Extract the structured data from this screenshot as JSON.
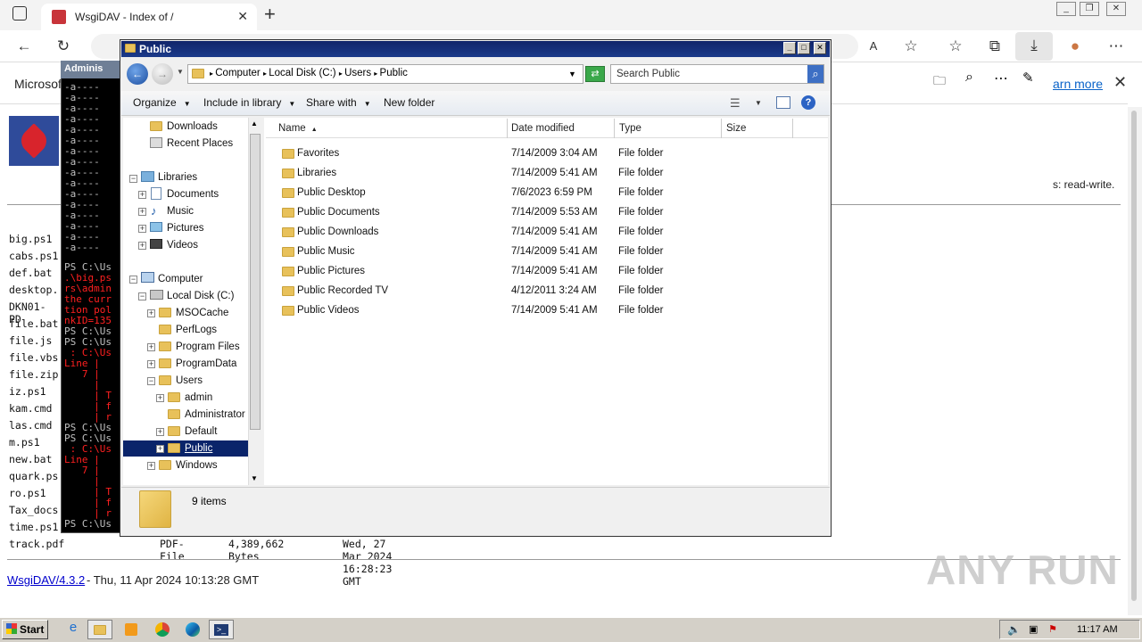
{
  "browser": {
    "tab_title": "WsgiDAV - Index of /",
    "tab_close": "✕",
    "new_tab": "+",
    "window_controls": [
      "_",
      "❐",
      "✕"
    ]
  },
  "page": {
    "banner_text": "Microsof",
    "learn_more": "arn more",
    "banner_close": "✕",
    "permission_text": "s: read-write.",
    "files": [
      "big.ps1",
      "cabs.ps1",
      "def.bat",
      "desktop.",
      "DKN01-PD",
      "file.bat",
      "file.js",
      "file.vbs",
      "file.zip",
      "iz.ps1",
      "kam.cmd",
      "las.cmd",
      "m.ps1",
      "new.bat",
      "quark.ps",
      "ro.ps1",
      "Tax_docs",
      "time.ps1"
    ],
    "track_row": {
      "name": "track.pdf",
      "type": "PDF-File",
      "size": "4,389,662 Bytes",
      "date": "Wed, 27 Mar 2024 16:28:23 GMT"
    },
    "footer_link": "WsgiDAV/4.3.2",
    "footer_text": " - Thu, 11 Apr 2024 10:13:28 GMT",
    "watermark": "ANY RUN"
  },
  "console": {
    "title": "Adminis",
    "attr_lines": [
      "-a----",
      "-a----",
      "-a----",
      "-a----",
      "-a----",
      "-a----",
      "-a----",
      "-a----",
      "-a----",
      "-a----",
      "-a----",
      "-a----",
      "-a----",
      "-a----",
      "-a----",
      "-a----"
    ],
    "lines": [
      {
        "text": "PS C:\\Us",
        "color": "#c0c0c0"
      },
      {
        "text": ".\\big.ps",
        "color": "#ff2020"
      },
      {
        "text": "rs\\admin",
        "color": "#ff2020"
      },
      {
        "text": "the curr",
        "color": "#ff2020"
      },
      {
        "text": "tion pol",
        "color": "#ff2020"
      },
      {
        "text": "nkID=135",
        "color": "#ff2020"
      },
      {
        "text": "PS C:\\Us",
        "color": "#c0c0c0"
      },
      {
        "text": "PS C:\\Us",
        "color": "#c0c0c0"
      },
      {
        "text": " : C:\\Us",
        "color": "#ff2020"
      },
      {
        "text": "Line |",
        "color": "#ff2020"
      },
      {
        "text": "   7 |",
        "color": "#ff2020"
      },
      {
        "text": "     |",
        "color": "#ff2020"
      },
      {
        "text": "     | T",
        "color": "#ff2020"
      },
      {
        "text": "     | f",
        "color": "#ff2020"
      },
      {
        "text": "     | r",
        "color": "#ff2020"
      },
      {
        "text": "PS C:\\Us",
        "color": "#c0c0c0"
      },
      {
        "text": "PS C:\\Us",
        "color": "#c0c0c0"
      },
      {
        "text": " : C:\\Us",
        "color": "#ff2020"
      },
      {
        "text": "Line |",
        "color": "#ff2020"
      },
      {
        "text": "   7 |",
        "color": "#ff2020"
      },
      {
        "text": "     |",
        "color": "#ff2020"
      },
      {
        "text": "     | T",
        "color": "#ff2020"
      },
      {
        "text": "     | f",
        "color": "#ff2020"
      },
      {
        "text": "     | r",
        "color": "#ff2020"
      },
      {
        "text": "PS C:\\Us",
        "color": "#c0c0c0"
      }
    ]
  },
  "explorer": {
    "title": "Public",
    "breadcrumb": [
      "Computer",
      "Local Disk (C:)",
      "Users",
      "Public"
    ],
    "search_placeholder": "Search Public",
    "commands": [
      "Organize",
      "Include in library",
      "Share with",
      "New folder"
    ],
    "nav": {
      "downloads": "Downloads",
      "recent": "Recent Places",
      "libraries": "Libraries",
      "documents": "Documents",
      "music": "Music",
      "pictures": "Pictures",
      "videos": "Videos",
      "computer": "Computer",
      "local_disk": "Local Disk (C:)",
      "msocache": "MSOCache",
      "perflogs": "PerfLogs",
      "program_files": "Program Files",
      "programdata": "ProgramData",
      "users": "Users",
      "admin": "admin",
      "administrator": "Administrator",
      "default": "Default",
      "public": "Public",
      "windows": "Windows"
    },
    "columns": [
      "Name",
      "Date modified",
      "Type",
      "Size"
    ],
    "rows": [
      {
        "name": "Favorites",
        "date": "7/14/2009 3:04 AM",
        "type": "File folder"
      },
      {
        "name": "Libraries",
        "date": "7/14/2009 5:41 AM",
        "type": "File folder"
      },
      {
        "name": "Public Desktop",
        "date": "7/6/2023 6:59 PM",
        "type": "File folder"
      },
      {
        "name": "Public Documents",
        "date": "7/14/2009 5:53 AM",
        "type": "File folder"
      },
      {
        "name": "Public Downloads",
        "date": "7/14/2009 5:41 AM",
        "type": "File folder"
      },
      {
        "name": "Public Music",
        "date": "7/14/2009 5:41 AM",
        "type": "File folder"
      },
      {
        "name": "Public Pictures",
        "date": "7/14/2009 5:41 AM",
        "type": "File folder"
      },
      {
        "name": "Public Recorded TV",
        "date": "4/12/2011 3:24 AM",
        "type": "File folder"
      },
      {
        "name": "Public Videos",
        "date": "7/14/2009 5:41 AM",
        "type": "File folder"
      }
    ],
    "status": "9 items"
  },
  "taskbar": {
    "start": "Start",
    "clock": "11:17 AM"
  },
  "colors": {
    "title_bar": "#0a246a",
    "selection": "#0a246a",
    "console_error": "#ff2020",
    "link": "#0000cc"
  }
}
